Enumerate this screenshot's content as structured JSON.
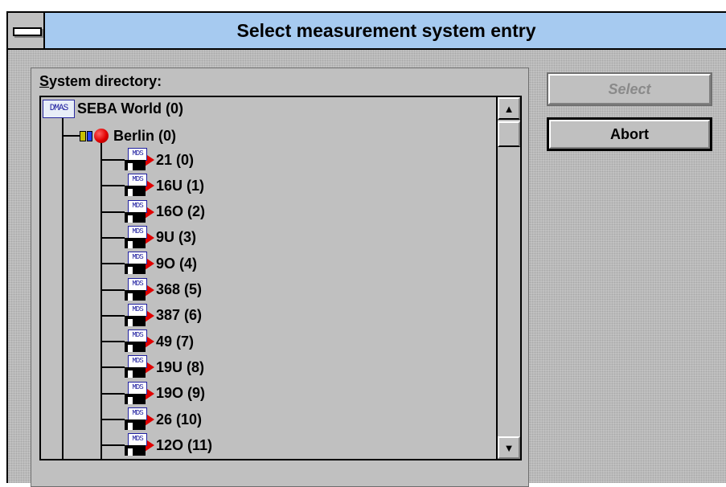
{
  "window": {
    "title": "Select measurement system entry"
  },
  "panel": {
    "label_accel": "S",
    "label_rest": "ystem directory:"
  },
  "tree": {
    "root": {
      "icon_text": "DMAS",
      "label": "SEBA World (0)"
    },
    "node": {
      "label": "Berlin (0)"
    },
    "mds_icon_text": "MDS",
    "items": [
      {
        "label": "21 (0)"
      },
      {
        "label": "16U (1)"
      },
      {
        "label": "16O (2)"
      },
      {
        "label": "9U (3)"
      },
      {
        "label": "9O (4)"
      },
      {
        "label": "368 (5)"
      },
      {
        "label": "387 (6)"
      },
      {
        "label": "49 (7)"
      },
      {
        "label": "19U (8)"
      },
      {
        "label": "19O (9)"
      },
      {
        "label": "26 (10)"
      },
      {
        "label": "12O (11)"
      }
    ]
  },
  "buttons": {
    "select_label": "Select",
    "abort_label": "Abort"
  },
  "icons": {
    "sysmenu": "system-menu-icon",
    "root": "dmas-icon",
    "node": "red-ball-icon",
    "item": "mds-disk-icon",
    "item_arrow": "red-arrow-icon",
    "scroll_up": "scroll-up-arrow-icon",
    "scroll_down": "scroll-down-arrow-icon"
  },
  "colors": {
    "title_bg": "#a6caf0",
    "client_bg": "#c3c3c3",
    "node_red": "#e00000"
  }
}
